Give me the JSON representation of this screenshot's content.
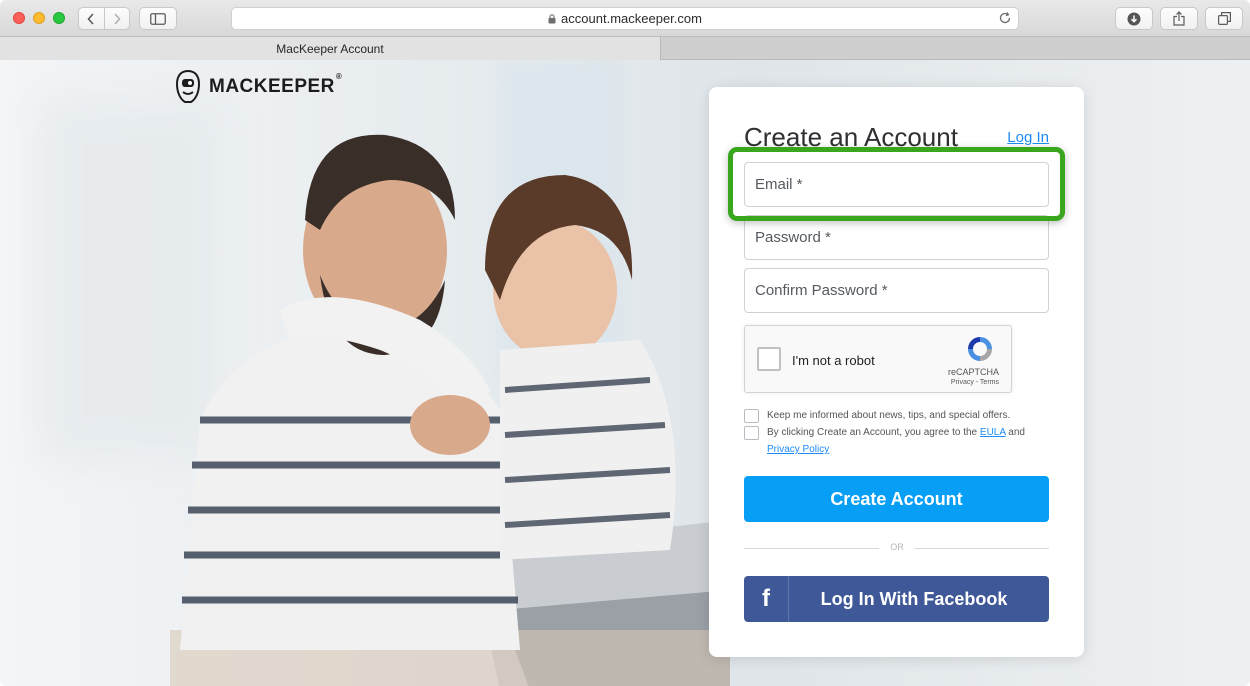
{
  "browser": {
    "url": "account.mackeeper.com",
    "tab_title": "MacKeeper Account"
  },
  "logo": {
    "text": "MACKEEPER",
    "registered": "®"
  },
  "form": {
    "title": "Create an Account",
    "login_link": "Log In",
    "email_placeholder": "Email *",
    "password_placeholder": "Password *",
    "confirm_placeholder": "Confirm Password *",
    "recaptcha": {
      "label": "I'm not a robot",
      "brand": "reCAPTCHA",
      "terms": "Privacy - Terms"
    },
    "newsletter_text": "Keep me informed about news, tips, and special offers.",
    "agree_text": "By clicking Create an Account, you agree to the",
    "eula_link": "EULA",
    "and_text": "and",
    "privacy_link": "Privacy Policy",
    "create_button": "Create Account",
    "or_text": "OR",
    "facebook_button": "Log In With Facebook",
    "facebook_icon_glyph": "f"
  },
  "colors": {
    "primary_button": "#079ff5",
    "facebook": "#3f5897",
    "link": "#1d8cf8",
    "highlight": "#3aa61e"
  }
}
